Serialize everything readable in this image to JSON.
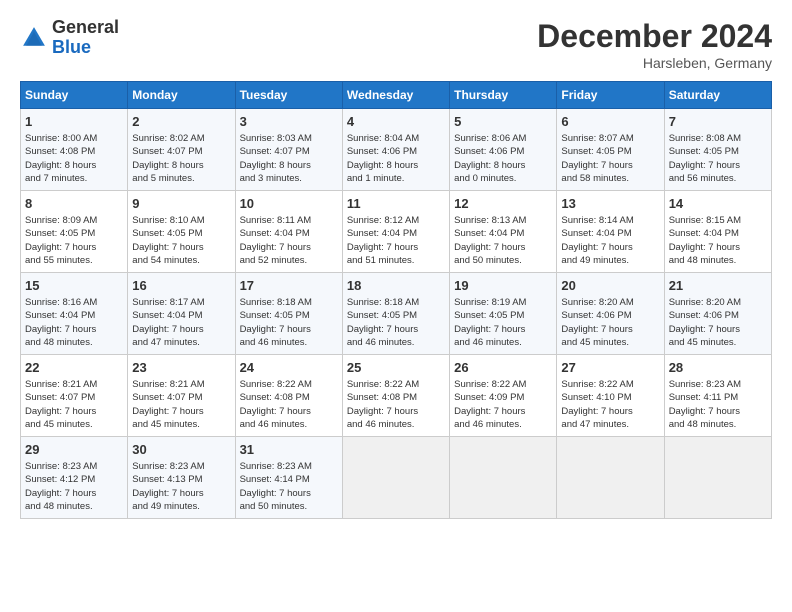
{
  "header": {
    "logo_general": "General",
    "logo_blue": "Blue",
    "month": "December 2024",
    "location": "Harsleben, Germany"
  },
  "days_of_week": [
    "Sunday",
    "Monday",
    "Tuesday",
    "Wednesday",
    "Thursday",
    "Friday",
    "Saturday"
  ],
  "weeks": [
    [
      {
        "day": 1,
        "lines": [
          "Sunrise: 8:00 AM",
          "Sunset: 4:08 PM",
          "Daylight: 8 hours",
          "and 7 minutes."
        ]
      },
      {
        "day": 2,
        "lines": [
          "Sunrise: 8:02 AM",
          "Sunset: 4:07 PM",
          "Daylight: 8 hours",
          "and 5 minutes."
        ]
      },
      {
        "day": 3,
        "lines": [
          "Sunrise: 8:03 AM",
          "Sunset: 4:07 PM",
          "Daylight: 8 hours",
          "and 3 minutes."
        ]
      },
      {
        "day": 4,
        "lines": [
          "Sunrise: 8:04 AM",
          "Sunset: 4:06 PM",
          "Daylight: 8 hours",
          "and 1 minute."
        ]
      },
      {
        "day": 5,
        "lines": [
          "Sunrise: 8:06 AM",
          "Sunset: 4:06 PM",
          "Daylight: 8 hours",
          "and 0 minutes."
        ]
      },
      {
        "day": 6,
        "lines": [
          "Sunrise: 8:07 AM",
          "Sunset: 4:05 PM",
          "Daylight: 7 hours",
          "and 58 minutes."
        ]
      },
      {
        "day": 7,
        "lines": [
          "Sunrise: 8:08 AM",
          "Sunset: 4:05 PM",
          "Daylight: 7 hours",
          "and 56 minutes."
        ]
      }
    ],
    [
      {
        "day": 8,
        "lines": [
          "Sunrise: 8:09 AM",
          "Sunset: 4:05 PM",
          "Daylight: 7 hours",
          "and 55 minutes."
        ]
      },
      {
        "day": 9,
        "lines": [
          "Sunrise: 8:10 AM",
          "Sunset: 4:05 PM",
          "Daylight: 7 hours",
          "and 54 minutes."
        ]
      },
      {
        "day": 10,
        "lines": [
          "Sunrise: 8:11 AM",
          "Sunset: 4:04 PM",
          "Daylight: 7 hours",
          "and 52 minutes."
        ]
      },
      {
        "day": 11,
        "lines": [
          "Sunrise: 8:12 AM",
          "Sunset: 4:04 PM",
          "Daylight: 7 hours",
          "and 51 minutes."
        ]
      },
      {
        "day": 12,
        "lines": [
          "Sunrise: 8:13 AM",
          "Sunset: 4:04 PM",
          "Daylight: 7 hours",
          "and 50 minutes."
        ]
      },
      {
        "day": 13,
        "lines": [
          "Sunrise: 8:14 AM",
          "Sunset: 4:04 PM",
          "Daylight: 7 hours",
          "and 49 minutes."
        ]
      },
      {
        "day": 14,
        "lines": [
          "Sunrise: 8:15 AM",
          "Sunset: 4:04 PM",
          "Daylight: 7 hours",
          "and 48 minutes."
        ]
      }
    ],
    [
      {
        "day": 15,
        "lines": [
          "Sunrise: 8:16 AM",
          "Sunset: 4:04 PM",
          "Daylight: 7 hours",
          "and 48 minutes."
        ]
      },
      {
        "day": 16,
        "lines": [
          "Sunrise: 8:17 AM",
          "Sunset: 4:04 PM",
          "Daylight: 7 hours",
          "and 47 minutes."
        ]
      },
      {
        "day": 17,
        "lines": [
          "Sunrise: 8:18 AM",
          "Sunset: 4:05 PM",
          "Daylight: 7 hours",
          "and 46 minutes."
        ]
      },
      {
        "day": 18,
        "lines": [
          "Sunrise: 8:18 AM",
          "Sunset: 4:05 PM",
          "Daylight: 7 hours",
          "and 46 minutes."
        ]
      },
      {
        "day": 19,
        "lines": [
          "Sunrise: 8:19 AM",
          "Sunset: 4:05 PM",
          "Daylight: 7 hours",
          "and 46 minutes."
        ]
      },
      {
        "day": 20,
        "lines": [
          "Sunrise: 8:20 AM",
          "Sunset: 4:06 PM",
          "Daylight: 7 hours",
          "and 45 minutes."
        ]
      },
      {
        "day": 21,
        "lines": [
          "Sunrise: 8:20 AM",
          "Sunset: 4:06 PM",
          "Daylight: 7 hours",
          "and 45 minutes."
        ]
      }
    ],
    [
      {
        "day": 22,
        "lines": [
          "Sunrise: 8:21 AM",
          "Sunset: 4:07 PM",
          "Daylight: 7 hours",
          "and 45 minutes."
        ]
      },
      {
        "day": 23,
        "lines": [
          "Sunrise: 8:21 AM",
          "Sunset: 4:07 PM",
          "Daylight: 7 hours",
          "and 45 minutes."
        ]
      },
      {
        "day": 24,
        "lines": [
          "Sunrise: 8:22 AM",
          "Sunset: 4:08 PM",
          "Daylight: 7 hours",
          "and 46 minutes."
        ]
      },
      {
        "day": 25,
        "lines": [
          "Sunrise: 8:22 AM",
          "Sunset: 4:08 PM",
          "Daylight: 7 hours",
          "and 46 minutes."
        ]
      },
      {
        "day": 26,
        "lines": [
          "Sunrise: 8:22 AM",
          "Sunset: 4:09 PM",
          "Daylight: 7 hours",
          "and 46 minutes."
        ]
      },
      {
        "day": 27,
        "lines": [
          "Sunrise: 8:22 AM",
          "Sunset: 4:10 PM",
          "Daylight: 7 hours",
          "and 47 minutes."
        ]
      },
      {
        "day": 28,
        "lines": [
          "Sunrise: 8:23 AM",
          "Sunset: 4:11 PM",
          "Daylight: 7 hours",
          "and 48 minutes."
        ]
      }
    ],
    [
      {
        "day": 29,
        "lines": [
          "Sunrise: 8:23 AM",
          "Sunset: 4:12 PM",
          "Daylight: 7 hours",
          "and 48 minutes."
        ]
      },
      {
        "day": 30,
        "lines": [
          "Sunrise: 8:23 AM",
          "Sunset: 4:13 PM",
          "Daylight: 7 hours",
          "and 49 minutes."
        ]
      },
      {
        "day": 31,
        "lines": [
          "Sunrise: 8:23 AM",
          "Sunset: 4:14 PM",
          "Daylight: 7 hours",
          "and 50 minutes."
        ]
      },
      null,
      null,
      null,
      null
    ]
  ]
}
